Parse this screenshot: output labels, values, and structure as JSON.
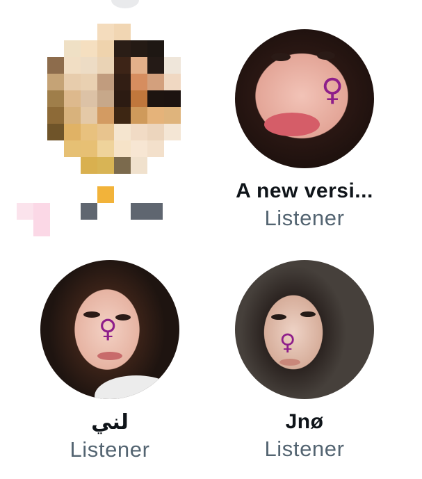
{
  "listeners": [
    {
      "name": "",
      "role": ""
    },
    {
      "name": "A new versi...",
      "role": "Listener"
    },
    {
      "name": "لني",
      "role": "Listener"
    },
    {
      "name": "Jnø",
      "role": "Listener"
    }
  ],
  "icons": {
    "cheek_symbol": "♀"
  },
  "colors": {
    "name": "#0f1419",
    "role": "#536471",
    "symbol": "#8e1e8a"
  }
}
